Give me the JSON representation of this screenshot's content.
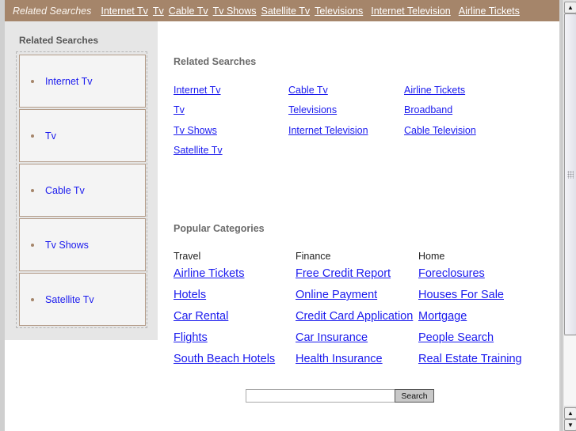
{
  "topbar": {
    "label": "Related Searches",
    "links": [
      "Internet Tv",
      "Tv",
      "Cable Tv",
      "Tv Shows",
      "Satellite Tv",
      "Televisions",
      "Internet Television",
      "Airline Tickets"
    ]
  },
  "sidebar": {
    "title": "Related Searches",
    "items": [
      "Internet Tv",
      "Tv",
      "Cable Tv",
      "Tv Shows",
      "Satellite Tv"
    ]
  },
  "related": {
    "title": "Related Searches",
    "columns": [
      [
        "Internet Tv",
        "Tv",
        "Tv Shows",
        "Satellite Tv"
      ],
      [
        "Cable Tv",
        "Televisions",
        "Internet Television"
      ],
      [
        "Airline Tickets",
        "Broadband",
        "Cable Television"
      ]
    ]
  },
  "popular": {
    "title": "Popular Categories",
    "categories": [
      {
        "name": "Travel",
        "links": [
          "Airline Tickets",
          "Hotels",
          "Car Rental",
          "Flights",
          "South Beach Hotels"
        ]
      },
      {
        "name": "Finance",
        "links": [
          "Free Credit Report",
          "Online Payment",
          "Credit Card Application",
          "Car Insurance",
          "Health Insurance"
        ]
      },
      {
        "name": "Home",
        "links": [
          "Foreclosures",
          "Houses For Sale",
          "Mortgage",
          "People Search",
          "Real Estate Training"
        ]
      }
    ]
  },
  "search": {
    "input_value": "",
    "button_label": "Search"
  },
  "scrollbar": {
    "up_icon": "arrow-up-icon",
    "down_icon": "arrow-down-icon"
  }
}
